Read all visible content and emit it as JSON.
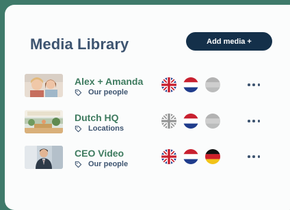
{
  "header": {
    "title": "Media Library",
    "add_button": "Add media +"
  },
  "colors": {
    "background": "#3f7a6a",
    "accent_green": "#3d7a5e",
    "navy": "#14304a",
    "text": "#3d5470"
  },
  "rows": [
    {
      "name": "Alex + Amanda",
      "category": "Our people",
      "thumbnail": "two-people-photo",
      "languages": [
        {
          "flag": "uk-flag",
          "active": true
        },
        {
          "flag": "nl-flag",
          "active": true
        },
        {
          "flag": "blank-flag",
          "active": false
        }
      ]
    },
    {
      "name": "Dutch HQ",
      "category": "Locations",
      "thumbnail": "office-interior-photo",
      "languages": [
        {
          "flag": "uk-flag",
          "active": false
        },
        {
          "flag": "nl-flag",
          "active": true
        },
        {
          "flag": "blank-flag",
          "active": false
        }
      ]
    },
    {
      "name": "CEO Video",
      "category": "Our people",
      "thumbnail": "ceo-portrait-photo",
      "languages": [
        {
          "flag": "uk-flag",
          "active": true
        },
        {
          "flag": "nl-flag",
          "active": true
        },
        {
          "flag": "de-flag",
          "active": true
        }
      ]
    }
  ]
}
